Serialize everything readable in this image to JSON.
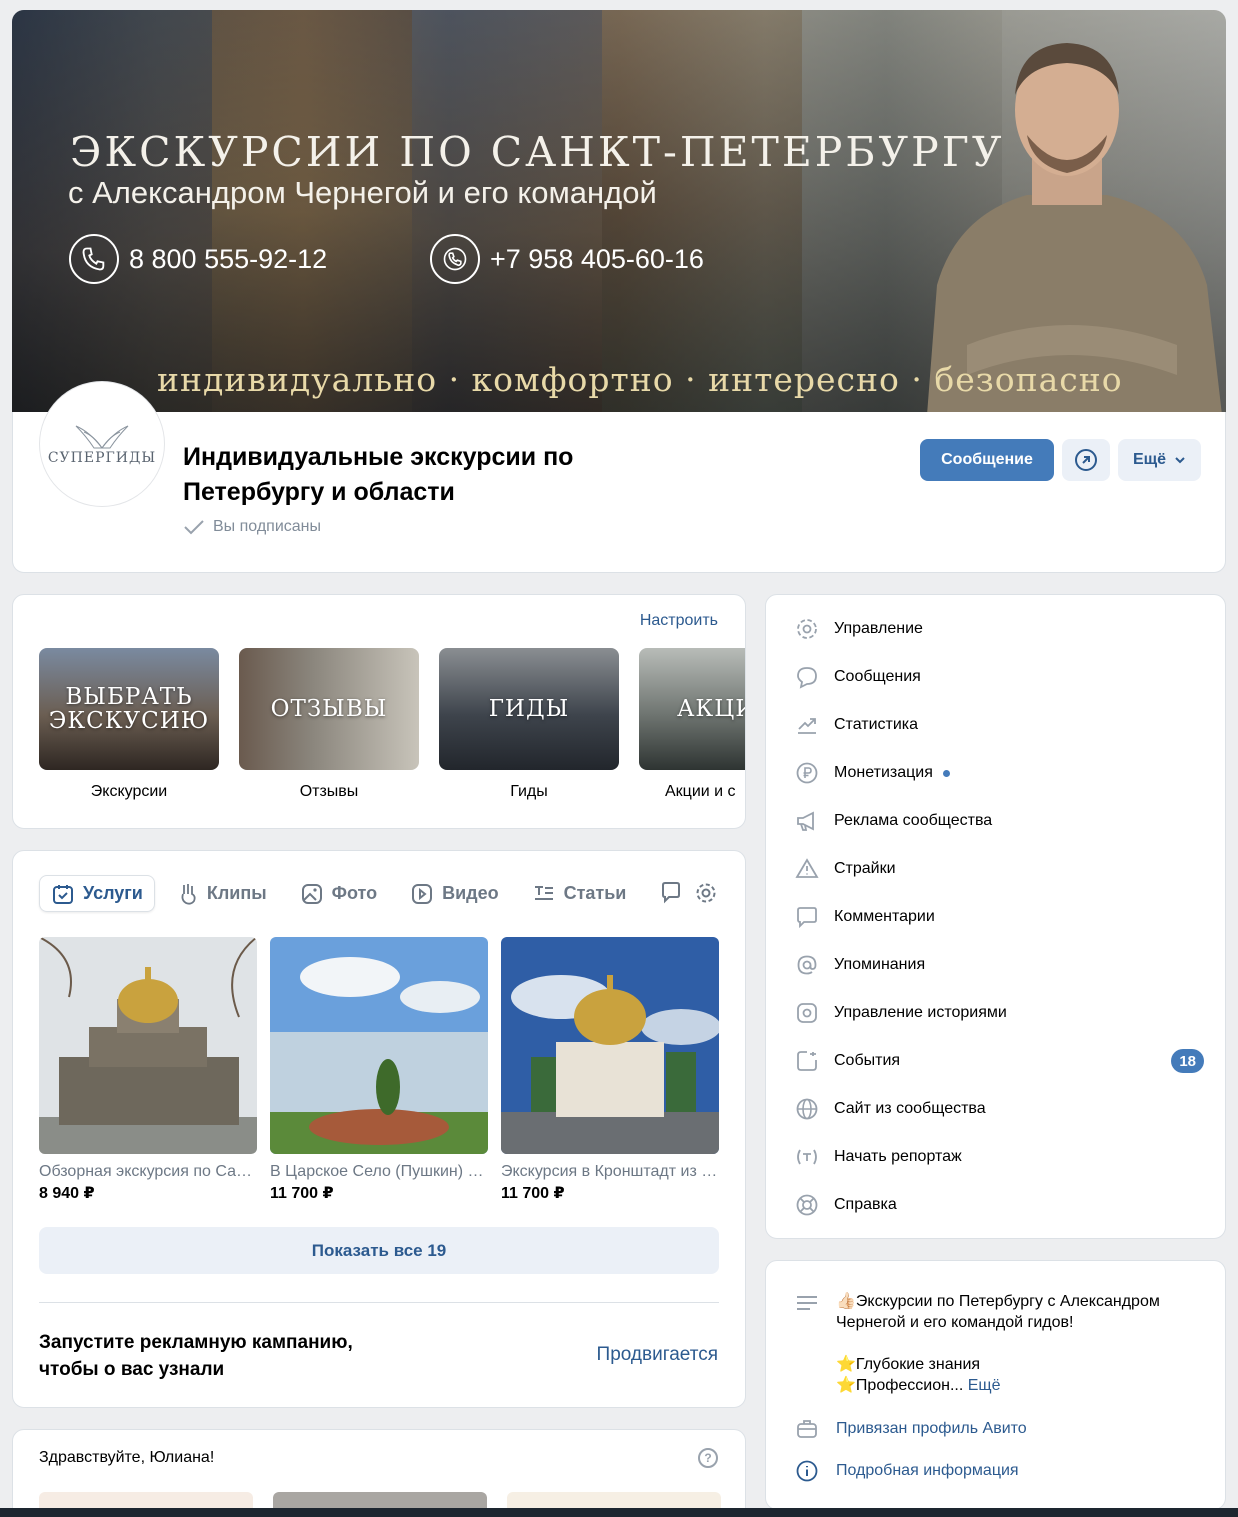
{
  "cover": {
    "title": "ЭКСКУРСИИ ПО САНКТ-ПЕТЕРБУРГУ",
    "subtitle": "с Александром Чернегой и его командой",
    "phone1": "8 800 555-92-12",
    "phone2": "+7 958 405-60-16",
    "slogan": "индивидуально · комфортно · интересно · безопасно"
  },
  "header": {
    "avatar_text": "СУПЕРГИДЫ",
    "title": "Индивидуальные экскурсии по Петербургу и области",
    "subscribed": "Вы подписаны",
    "message_button": "Сообщение",
    "more_button": "Ещё"
  },
  "menu": {
    "configure": "Настроить",
    "items": [
      {
        "image_text": "ВЫБРАТЬ ЭКСКУСИЮ",
        "label": "Экскурсии"
      },
      {
        "image_text": "ОТЗЫВЫ",
        "label": "Отзывы"
      },
      {
        "image_text": "ГИДЫ",
        "label": "Гиды"
      },
      {
        "image_text": "АКЦИ",
        "label": "Акции и с"
      }
    ]
  },
  "services": {
    "tabs": [
      {
        "label": "Услуги",
        "icon": "calendar-check-icon"
      },
      {
        "label": "Клипы",
        "icon": "clips-icon"
      },
      {
        "label": "Фото",
        "icon": "photo-icon"
      },
      {
        "label": "Видео",
        "icon": "video-icon"
      },
      {
        "label": "Статьи",
        "icon": "articles-icon"
      }
    ],
    "products": [
      {
        "title": "Обзорная экскурсия по Санкт-Петербургу",
        "price": "8 940 ₽"
      },
      {
        "title": "В Царское Село (Пушкин) и Павловск",
        "price": "11 700 ₽"
      },
      {
        "title": "Экскурсия в Кронштадт из Петербурга",
        "price": "11 700 ₽"
      }
    ],
    "show_all": "Показать все 19",
    "promo_text": "Запустите рекламную кампанию, чтобы о вас узнали",
    "promo_link": "Продвигается"
  },
  "greeting": {
    "text": "Здравствуйте, Юлиана!"
  },
  "admin_menu": [
    {
      "label": "Управление",
      "icon": "gear-icon"
    },
    {
      "label": "Сообщения",
      "icon": "message-icon"
    },
    {
      "label": "Статистика",
      "icon": "stats-icon"
    },
    {
      "label": "Монетизация",
      "icon": "ruble-icon"
    },
    {
      "label": "Реклама сообщества",
      "icon": "megaphone-icon"
    },
    {
      "label": "Страйки",
      "icon": "warning-icon"
    },
    {
      "label": "Комментарии",
      "icon": "comment-icon"
    },
    {
      "label": "Упоминания",
      "icon": "at-icon"
    },
    {
      "label": "Управление историями",
      "icon": "stories-icon"
    },
    {
      "label": "События",
      "icon": "events-icon",
      "badge": "18"
    },
    {
      "label": "Сайт из сообщества",
      "icon": "globe-icon"
    },
    {
      "label": "Начать репортаж",
      "icon": "broadcast-icon"
    },
    {
      "label": "Справка",
      "icon": "help-lifebuoy-icon"
    }
  ],
  "info": {
    "desc_line1": "Экскурсии по Петербургу с Александром Чернегой и его командой гидов!",
    "desc_line2": "Глубокие знания",
    "desc_line3": "Профессион...",
    "desc_more": "Ещё",
    "avito": "Привязан профиль Авито",
    "details": "Подробная информация"
  },
  "colors": {
    "accent": "#447bba",
    "link": "#2c5a8f",
    "secondary_text": "#818c99",
    "background": "#edeef0"
  }
}
